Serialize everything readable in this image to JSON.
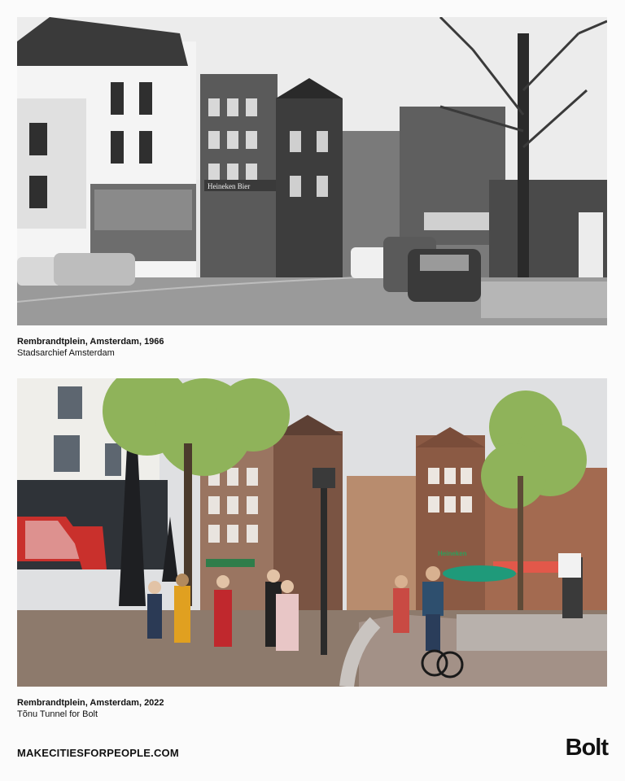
{
  "photo_top": {
    "alt": "Black and white photo of Rembrandtplein with old cars and buildings",
    "caption_title": "Rembrandtplein, Amsterdam, 1966",
    "caption_credit": "Stadsarchief Amsterdam",
    "sign_text": "Heineken Bier"
  },
  "photo_bottom": {
    "alt": "Color photo of Rembrandtplein with pedestrians, cyclists and trees",
    "caption_title": "Rembrandtplein, Amsterdam, 2022",
    "caption_credit": "Tõnu Tunnel for Bolt",
    "sign_text": "Heineken"
  },
  "footer": {
    "url": "MAKECITIESFORPEOPLE.COM",
    "logo": "Bolt"
  }
}
